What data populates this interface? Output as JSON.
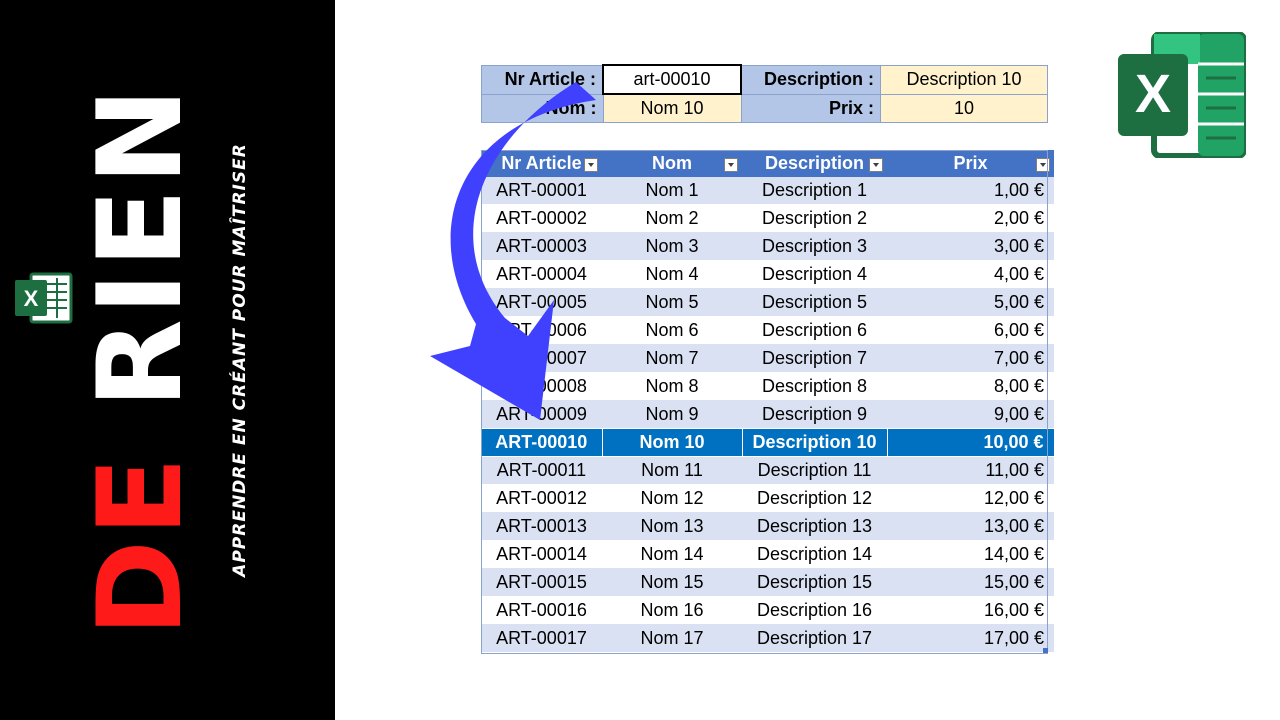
{
  "banner": {
    "word1": "DE",
    "word2": "RIEN",
    "subtitle": "APPRENDRE EN CRÉANT POUR MAÎTRISER",
    "logo_letter": "X"
  },
  "brand_logo": {
    "letter": "X",
    "icon": "excel-logo-icon",
    "color": "#1d6f42"
  },
  "form": {
    "article_label": "Nr Article :",
    "article_value": "art-00010",
    "description_label": "Description :",
    "description_value": "Description 10",
    "nom_label": "Nom :",
    "nom_value": "Nom 10",
    "prix_label": "Prix :",
    "prix_value": "10"
  },
  "table": {
    "headers": [
      "Nr Article",
      "Nom",
      "Description",
      "Prix"
    ],
    "selected_index": 9,
    "rows": [
      [
        "ART-00001",
        "Nom 1",
        "Description 1",
        "1,00 €"
      ],
      [
        "ART-00002",
        "Nom 2",
        "Description 2",
        "2,00 €"
      ],
      [
        "ART-00003",
        "Nom 3",
        "Description 3",
        "3,00 €"
      ],
      [
        "ART-00004",
        "Nom 4",
        "Description 4",
        "4,00 €"
      ],
      [
        "ART-00005",
        "Nom 5",
        "Description 5",
        "5,00 €"
      ],
      [
        "ART-00006",
        "Nom 6",
        "Description 6",
        "6,00 €"
      ],
      [
        "ART-00007",
        "Nom 7",
        "Description 7",
        "7,00 €"
      ],
      [
        "ART-00008",
        "Nom 8",
        "Description 8",
        "8,00 €"
      ],
      [
        "ART-00009",
        "Nom 9",
        "Description 9",
        "9,00 €"
      ],
      [
        "ART-00010",
        "Nom 10",
        "Description 10",
        "10,00 €"
      ],
      [
        "ART-00011",
        "Nom 11",
        "Description 11",
        "11,00 €"
      ],
      [
        "ART-00012",
        "Nom 12",
        "Description 12",
        "12,00 €"
      ],
      [
        "ART-00013",
        "Nom 13",
        "Description 13",
        "13,00 €"
      ],
      [
        "ART-00014",
        "Nom 14",
        "Description 14",
        "14,00 €"
      ],
      [
        "ART-00015",
        "Nom 15",
        "Description 15",
        "15,00 €"
      ],
      [
        "ART-00016",
        "Nom 16",
        "Description 16",
        "16,00 €"
      ],
      [
        "ART-00017",
        "Nom 17",
        "Description 17",
        "17,00 €"
      ]
    ]
  },
  "colors": {
    "header_blue": "#4472c4",
    "band_blue": "#d9e1f2",
    "selected_blue": "#0070c0",
    "input_yellow": "#fff2cc",
    "label_blue": "#b4c6e7",
    "arrow_blue": "#4040ff",
    "banner_red": "#ff1a1a"
  }
}
